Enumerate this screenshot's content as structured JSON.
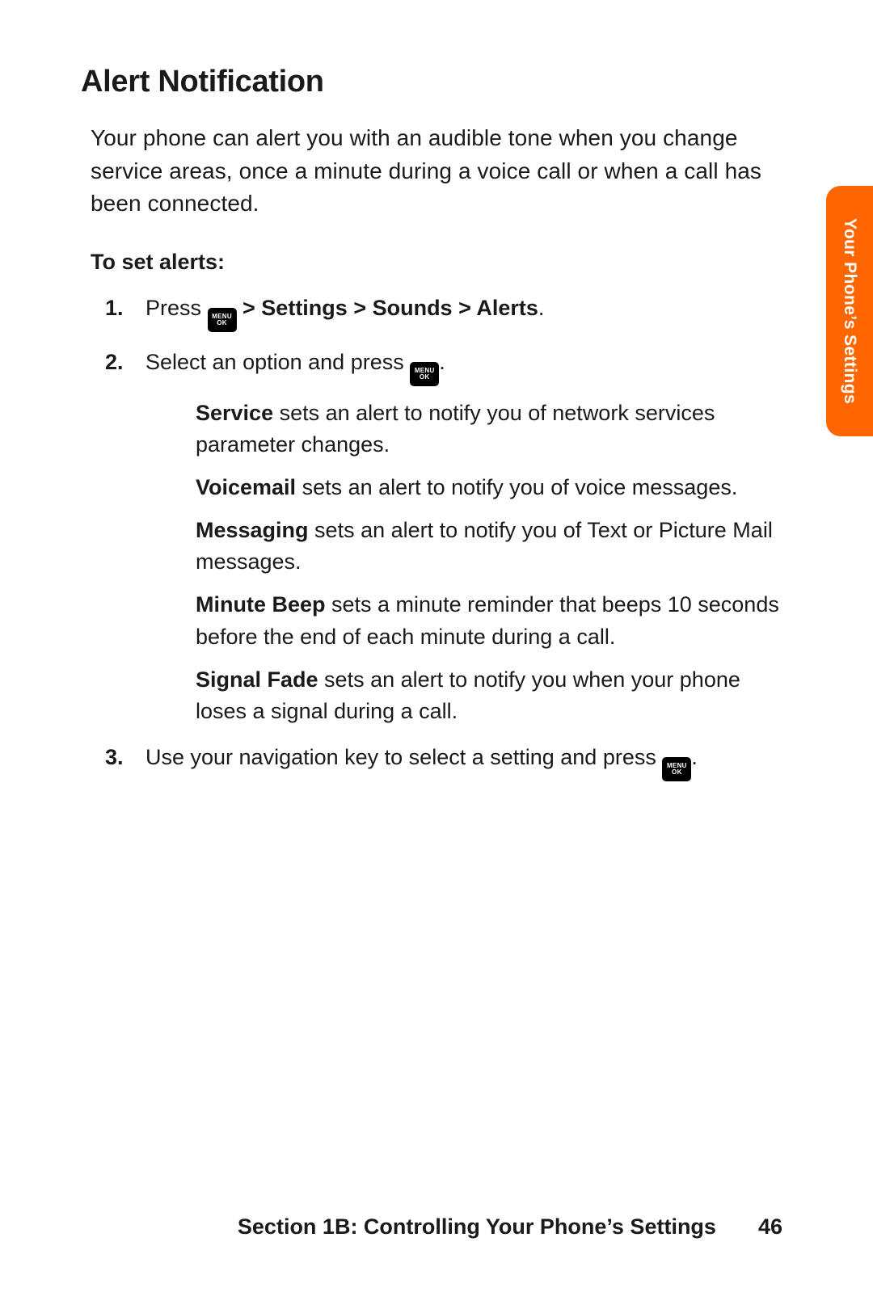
{
  "title": "Alert Notification",
  "intro": "Your phone can alert you with an audible tone when you change service areas, once a minute during a voice call or when a call has been connected.",
  "steps_heading": "To set alerts:",
  "menu_key": {
    "line1": "MENU",
    "line2": "OK"
  },
  "steps": [
    {
      "num": "1.",
      "pre": "Press ",
      "key": true,
      "post_bold": " > Settings > Sounds > Alerts",
      "post_plain": "."
    },
    {
      "num": "2.",
      "pre": "Select an option and press ",
      "key": true,
      "post_plain": ".",
      "defs": [
        {
          "term": "Service",
          "desc": " sets an alert to notify you of network services parameter changes."
        },
        {
          "term": "Voicemail",
          "desc": " sets an alert to notify you of voice messages."
        },
        {
          "term": "Messaging",
          "desc": " sets an alert to notify you of Text or Picture Mail messages."
        },
        {
          "term": "Minute Beep",
          "desc": " sets a minute reminder that beeps 10 seconds before the end of each minute during a call."
        },
        {
          "term": "Signal Fade",
          "desc": " sets an alert to notify you when your phone loses a signal during a call."
        }
      ]
    },
    {
      "num": "3.",
      "pre": "Use your navigation key to select a setting and press ",
      "key": true,
      "post_plain": "."
    }
  ],
  "tab_label": "Your Phone’s Settings",
  "footer_section": "Section 1B: Controlling Your Phone’s Settings",
  "footer_page": "46"
}
